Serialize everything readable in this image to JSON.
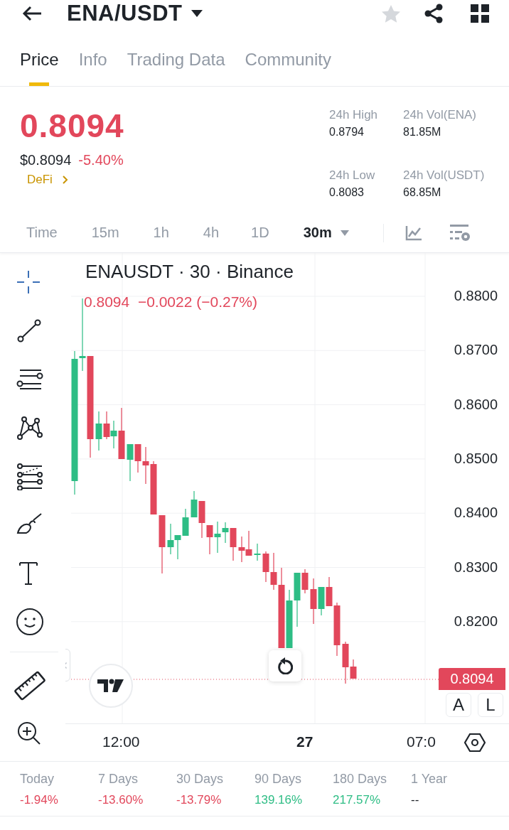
{
  "header": {
    "pair": "ENA/USDT",
    "favorite": false
  },
  "tabs": [
    {
      "label": "Price",
      "selected": true
    },
    {
      "label": "Info",
      "selected": false
    },
    {
      "label": "Trading Data",
      "selected": false
    },
    {
      "label": "Community",
      "selected": false
    }
  ],
  "price": {
    "last": "0.8094",
    "usd": "$0.8094",
    "change": "-5.40%",
    "color": "#e2475b",
    "tag": "DeFi"
  },
  "stats": [
    {
      "label": "24h High",
      "value": "0.8794"
    },
    {
      "label": "24h Vol(ENA)",
      "value": "81.85M"
    },
    {
      "label": "24h Low",
      "value": "0.8083"
    },
    {
      "label": "24h Vol(USDT)",
      "value": "68.85M"
    }
  ],
  "intervals": [
    {
      "label": "Time",
      "kind": "preset",
      "selected": false
    },
    {
      "label": "15m",
      "kind": "preset",
      "selected": false
    },
    {
      "label": "1h",
      "kind": "preset",
      "selected": false
    },
    {
      "label": "4h",
      "kind": "preset",
      "selected": false
    },
    {
      "label": "1D",
      "kind": "preset",
      "selected": false
    },
    {
      "label": "30m",
      "kind": "dropdown",
      "selected": true
    }
  ],
  "chart": {
    "title": "ENAUSDT · 30 · Binance",
    "ohlc": "0.8094  −0.0022 (−0.27%)",
    "color": "#e2475b",
    "y_ticks": [
      "0.8800",
      "0.8700",
      "0.8600",
      "0.8500",
      "0.8400",
      "0.8300",
      "0.8200"
    ],
    "x_ticks": [
      {
        "label": "12:00",
        "kind": "time"
      },
      {
        "label": "27",
        "kind": "day"
      },
      {
        "label": "07:0",
        "kind": "time"
      }
    ],
    "last_price": "0.8094",
    "scale_buttons": [
      "A",
      "L"
    ]
  },
  "performance": [
    {
      "period": "Today",
      "change": "-1.94%",
      "color": "#e2475b"
    },
    {
      "period": "7 Days",
      "change": "-13.60%",
      "color": "#e2475b"
    },
    {
      "period": "30 Days",
      "change": "-13.79%",
      "color": "#e2475b"
    },
    {
      "period": "90 Days",
      "change": "139.16%",
      "color": "#2ebd85"
    },
    {
      "period": "180 Days",
      "change": "217.57%",
      "color": "#2ebd85"
    },
    {
      "period": "1 Year",
      "change": "--",
      "color": "#1e2329"
    }
  ]
}
